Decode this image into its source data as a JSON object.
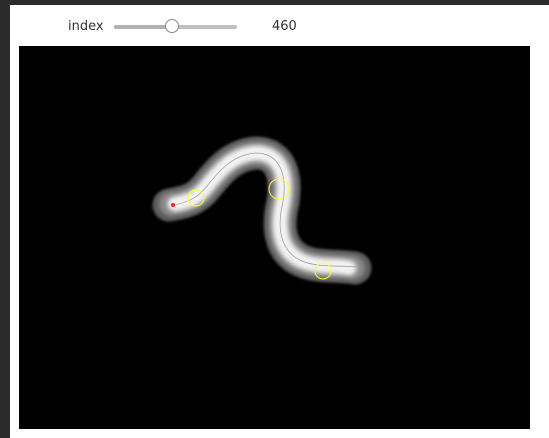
{
  "slider": {
    "label": "index",
    "value": "460",
    "level_fraction": 0.47
  },
  "image": {
    "kind": "worm-segmentation-view",
    "background": "#000000",
    "outer_glow_color": "#5a5a5a",
    "body_color": "#f2f2f2",
    "midline_color": "#9a9a9a",
    "marker_color": "#ffff33",
    "head_marker_color": "#ff2020"
  }
}
